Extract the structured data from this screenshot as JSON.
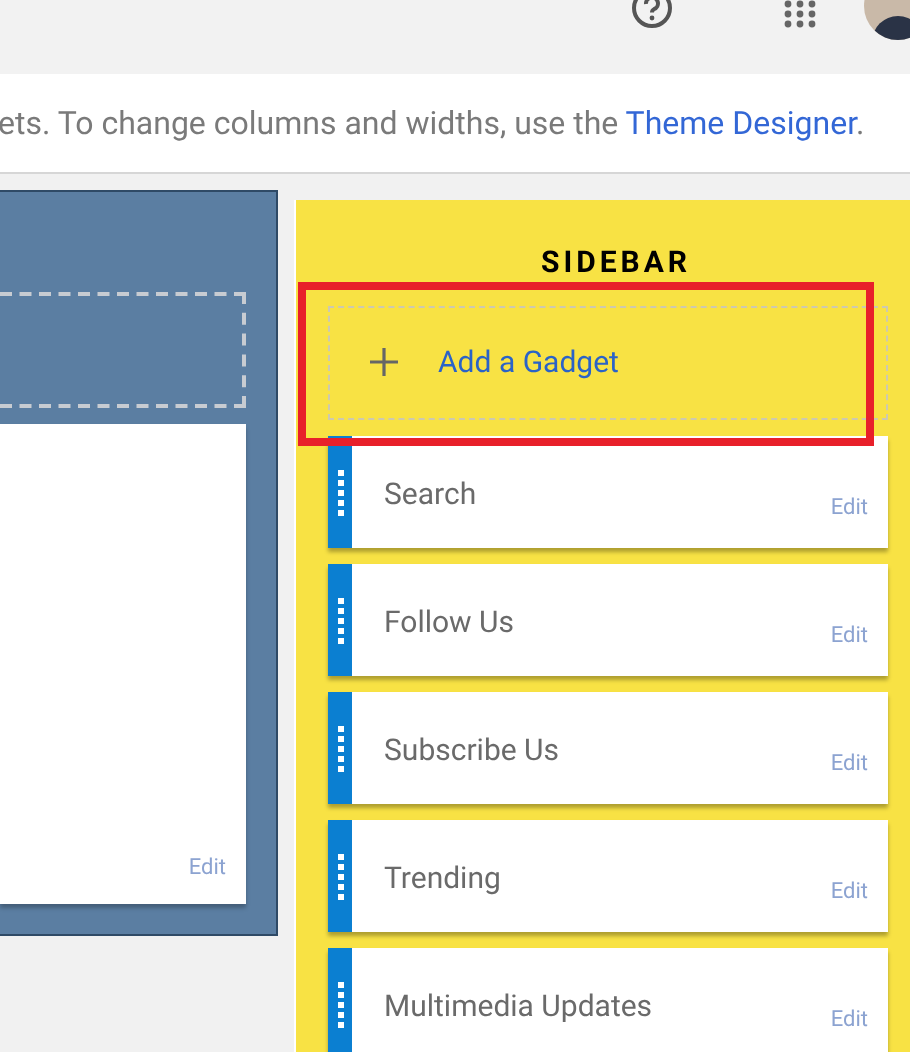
{
  "info_bar": {
    "text": "ets. To change columns and widths, use the",
    "link": "Theme Designer",
    "after": "."
  },
  "main_panel": {
    "edit": "Edit"
  },
  "sidebar": {
    "title": "SIDEBAR",
    "add_gadget": "Add a Gadget",
    "highlighted": true,
    "gadgets": [
      {
        "title": "Search",
        "edit": "Edit"
      },
      {
        "title": "Follow Us",
        "edit": "Edit"
      },
      {
        "title": "Subscribe Us",
        "edit": "Edit"
      },
      {
        "title": "Trending",
        "edit": "Edit"
      },
      {
        "title": "Multimedia Updates",
        "edit": "Edit"
      }
    ]
  }
}
